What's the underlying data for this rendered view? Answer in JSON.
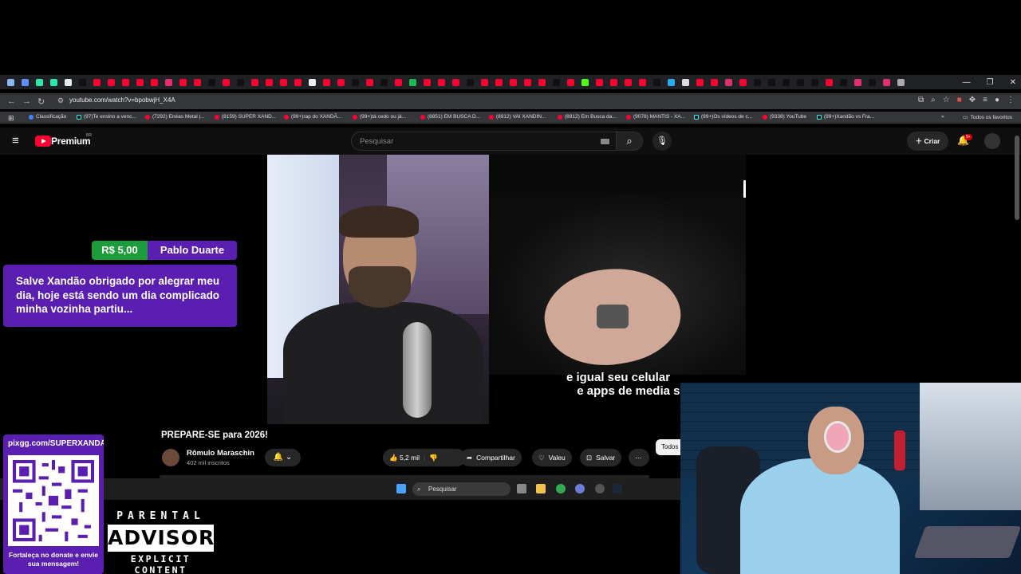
{
  "browser": {
    "url": "youtube.com/watch?v=bpobwjH_X4A",
    "bookmarks": [
      "Classificação",
      "(97)Te ensino a venc...",
      "(7292) Enéas Metal |...",
      "(8159) SUPER XAND...",
      "(99+)rap do XANDÃ...",
      "(99+)tá cedo ou já...",
      "(8851) EM BUSCA D...",
      "(8912) VAI XANDIN...",
      "(8912) Em Busca da...",
      "(9078) MANTIS - XA...",
      "(99+)Os vídeos de c...",
      "(9338) YouTube",
      "(99+)Xandão vs Fra..."
    ],
    "all_bookmarks": "Todos os favoritos"
  },
  "youtube": {
    "logo_text": "Premium",
    "region": "BR",
    "search_placeholder": "Pesquisar",
    "create_label": "Criar",
    "notif_count": "9+"
  },
  "video": {
    "subtitle_line1": "e igual seu celular",
    "subtitle_line2": "e apps de media soc",
    "title": "PREPARE-SE para 2026!",
    "channel_name": "Rômulo Maraschin",
    "subscribers": "402 mil inscritos",
    "likes": "5,2 mil",
    "share_label": "Compartilhar",
    "thanks_label": "Valeu",
    "save_label": "Salvar",
    "chip_label": "Todos"
  },
  "donation": {
    "amount": "R$ 5,00",
    "donor": "Pablo Duarte",
    "message": "Salve Xandão obrigado por alegrar meu dia, hoje está sendo um dia complicado minha vozinha partiu..."
  },
  "qr": {
    "url": "pixgg.com/SUPERXANDÃO",
    "message": "Fortaleça no donate e envie sua mensagem!"
  },
  "parental_advisory": {
    "top": "PARENTAL",
    "middle": "ADVISORY",
    "bottom": "EXPLICIT CONTENT"
  },
  "taskbar": {
    "search_placeholder": "Pesquisar"
  }
}
